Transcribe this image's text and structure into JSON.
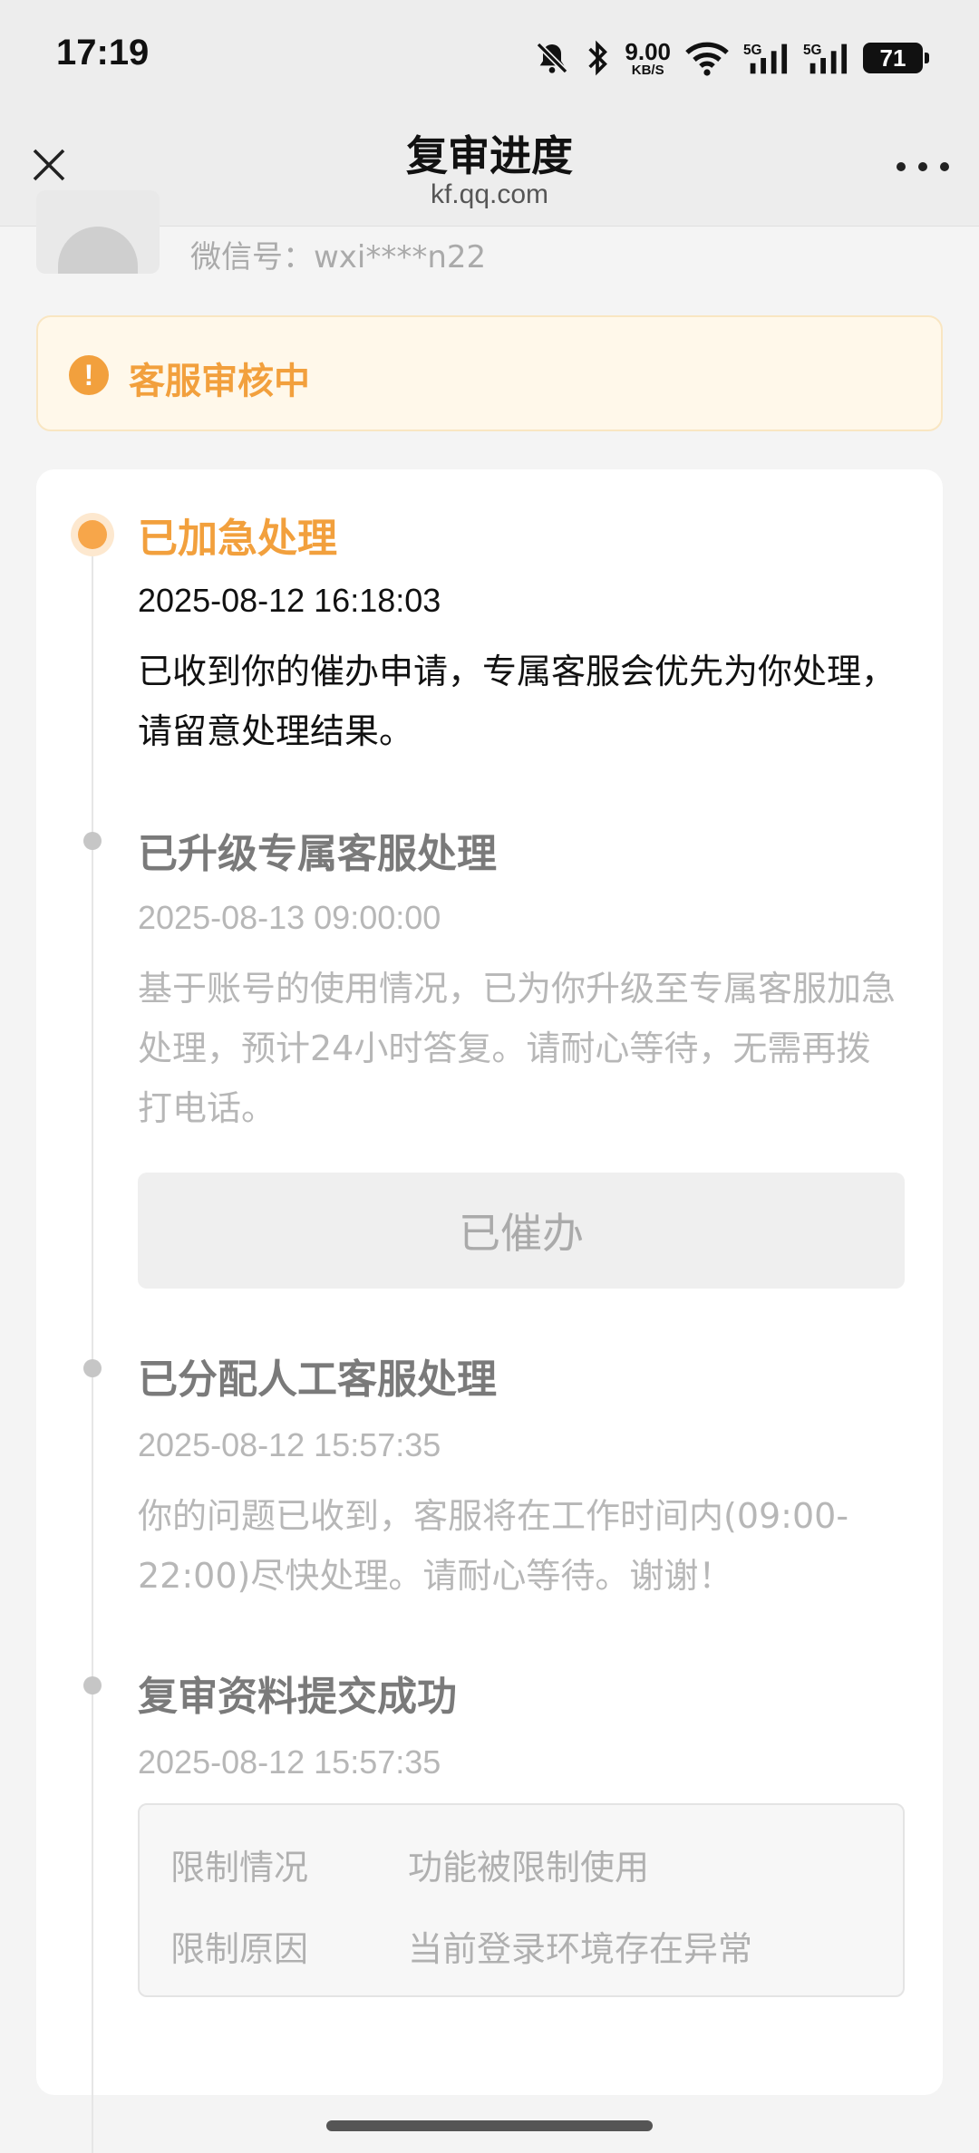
{
  "status_bar": {
    "time": "17:19",
    "speed_value": "9.00",
    "speed_unit": "KB/S",
    "battery": "71",
    "icons": [
      "mute-bell-icon",
      "bluetooth-icon",
      "wifi-icon",
      "signal-5g-icon",
      "signal-5g-icon"
    ]
  },
  "header": {
    "title": "复审进度",
    "url": "kf.qq.com"
  },
  "account": {
    "wechat_id": "微信号：wxi****n22"
  },
  "banner": {
    "status": "客服审核中",
    "icon_glyph": "!",
    "color": "#f2a03d"
  },
  "timeline": [
    {
      "title": "已加急处理",
      "time": "2025-08-12 16:18:03",
      "desc": "已收到你的催办申请，专属客服会优先为你处理，请留意处理结果。",
      "active": true
    },
    {
      "title": "已升级专属客服处理",
      "time": "2025-08-13 09:00:00",
      "desc": "基于账号的使用情况，已为你升级至专属客服加急处理，预计24小时答复。请耐心等待，无需再拨打电话。",
      "button": "已催办"
    },
    {
      "title": "已分配人工客服处理",
      "time": "2025-08-12 15:57:35",
      "desc": "你的问题已收到，客服将在工作时间内(09:00-22:00)尽快处理。请耐心等待。谢谢！"
    },
    {
      "title": "复审资料提交成功",
      "time": "2025-08-12 15:57:35",
      "details": [
        {
          "label": "限制情况",
          "value": "功能被限制使用"
        },
        {
          "label": "限制原因",
          "value": "当前登录环境存在异常"
        }
      ]
    }
  ]
}
